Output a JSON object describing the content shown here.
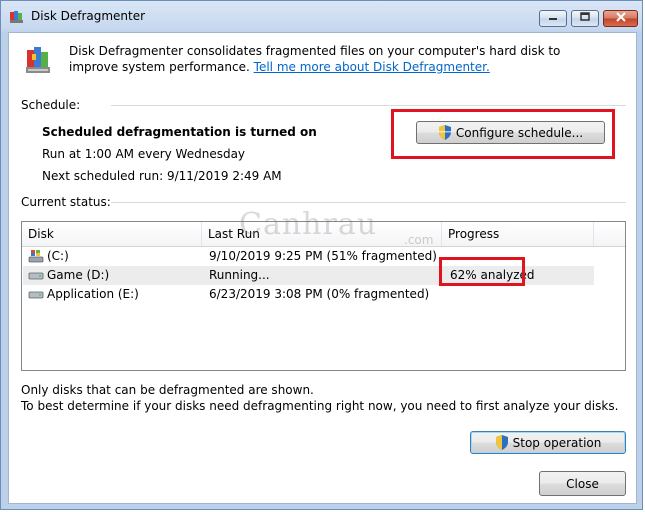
{
  "window": {
    "title": "Disk Defragmenter"
  },
  "intro": {
    "text": "Disk Defragmenter consolidates fragmented files on your computer's hard disk to improve system performance.",
    "link": "Tell me more about Disk Defragmenter."
  },
  "schedule": {
    "label": "Schedule:",
    "status": "Scheduled defragmentation is turned on",
    "run_at": "Run at 1:00 AM every Wednesday",
    "next_run": "Next scheduled run: 9/11/2019 2:49 AM",
    "configure_label": "Configure schedule..."
  },
  "current_status": {
    "label": "Current status:",
    "columns": [
      "Disk",
      "Last Run",
      "Progress"
    ],
    "rows": [
      {
        "disk": "(C:)",
        "last_run": "9/10/2019 9:25 PM (51% fragmented)",
        "progress": ""
      },
      {
        "disk": "Game (D:)",
        "last_run": "Running...",
        "progress": "62% analyzed"
      },
      {
        "disk": "Application (E:)",
        "last_run": "6/23/2019 3:08 PM (0% fragmented)",
        "progress": ""
      }
    ]
  },
  "footer": {
    "note1": "Only disks that can be defragmented are shown.",
    "note2": "To best determine if your disks need defragmenting right now, you need to first analyze your disks.",
    "stop_label": "Stop operation",
    "close_label": "Close"
  },
  "watermark": {
    "main": "Canhrau",
    "suffix": ".com"
  },
  "colors": {
    "highlight": "#e0141e",
    "link": "#0066cc"
  }
}
